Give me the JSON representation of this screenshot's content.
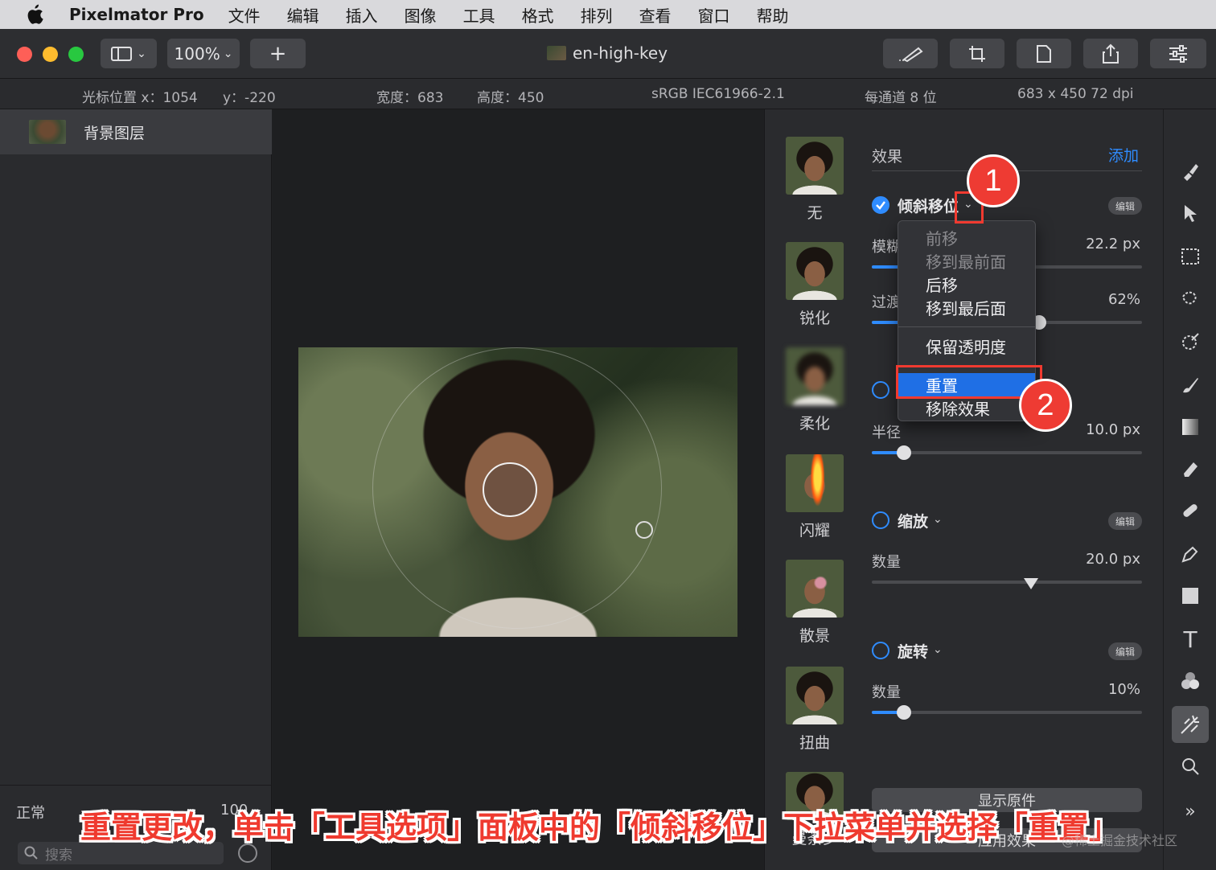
{
  "menubar": {
    "app_name": "Pixelmator Pro",
    "items": [
      "文件",
      "编辑",
      "插入",
      "图像",
      "工具",
      "格式",
      "排列",
      "查看",
      "窗口",
      "帮助"
    ]
  },
  "toolbar": {
    "zoom": "100%",
    "add": "+",
    "doc_title": "en-high-key"
  },
  "infobar": {
    "cursor_x": "光标位置 x：1054",
    "cursor_y": "y：-220",
    "width": "宽度：683",
    "height": "高度：450",
    "color_profile": "sRGB IEC61966-2.1",
    "bit_depth": "每通道 8 位",
    "size_dpi": "683 x 450 72 dpi"
  },
  "layers": {
    "layer_name": "背景图层",
    "blend_mode": "正常",
    "opacity": "100",
    "search_placeholder": "搜索"
  },
  "effects_browser": [
    {
      "label": "无"
    },
    {
      "label": "锐化"
    },
    {
      "label": "柔化"
    },
    {
      "label": "闪耀"
    },
    {
      "label": "散景"
    },
    {
      "label": "扭曲"
    },
    {
      "label": "曼荼罗"
    }
  ],
  "options": {
    "section_title": "效果",
    "add_label": "添加",
    "edit_label": "编辑",
    "tilt_shift": {
      "name": "倾斜移位",
      "param1": "模糊",
      "value1": "22.2 px",
      "param2": "过渡",
      "value2": "62%",
      "blur_fraction": 0.1,
      "transition_fraction": 0.62
    },
    "radius": {
      "param": "半径",
      "value": "10.0 px",
      "fraction": 0.12
    },
    "zoom_fx": {
      "name": "缩放",
      "param": "数量",
      "value": "20.0 px",
      "fraction": 0.59
    },
    "rotate_fx": {
      "name": "旋转",
      "param": "数量",
      "value": "10%",
      "fraction": 0.12
    },
    "show_original": "显示原件",
    "apply_effects": "应用效果"
  },
  "dropdown": {
    "items": [
      "前移",
      "移到最前面",
      "后移",
      "移到最后面"
    ],
    "preserve": "保留透明度",
    "reset": "重置",
    "remove": "移除效果"
  },
  "annotations": {
    "badge1": "1",
    "badge2": "2",
    "caption": "重置更改，单击「工具选项」面板中的「倾斜移位」下拉菜单并选择「重置」",
    "watermark": "@稀土掘金技术社区"
  },
  "colors": {
    "accent": "#2f8cff",
    "highlight": "#1f6fe5",
    "annotation_red": "#ee3b33"
  }
}
